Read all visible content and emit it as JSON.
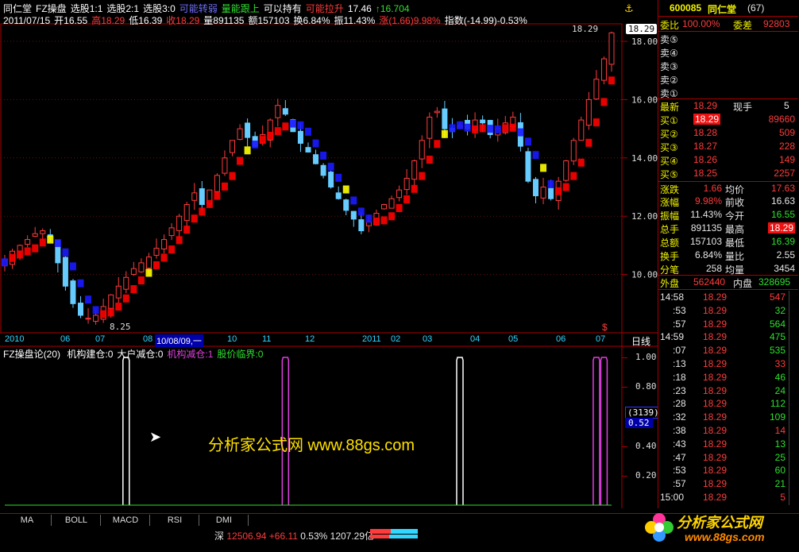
{
  "header": {
    "line1": [
      {
        "text": "同仁堂",
        "color": "#ffffff"
      },
      {
        "text": "FZ操盘",
        "color": "#ffffff"
      },
      {
        "text": "选股1:1",
        "color": "#ffffff"
      },
      {
        "text": "选股2:1",
        "color": "#ffffff"
      },
      {
        "text": "选股3:0",
        "color": "#ffffff"
      },
      {
        "text": "可能转弱",
        "color": "#6f6fff"
      },
      {
        "text": "量能跟上",
        "color": "#2ee02e"
      },
      {
        "text": "可以持有",
        "color": "#ffffff"
      },
      {
        "text": "可能拉升",
        "color": "#ff3b3b"
      },
      {
        "text": "17.46",
        "color": "#ffffff"
      },
      {
        "text": "↑16.704",
        "color": "#2ee02e"
      }
    ],
    "line2": [
      {
        "text": "2011/07/15",
        "color": "#ffffff"
      },
      {
        "text": "开16.55",
        "color": "#ffffff"
      },
      {
        "text": "高18.29",
        "color": "#ff3b3b"
      },
      {
        "text": "低16.39",
        "color": "#ffffff"
      },
      {
        "text": "收18.29",
        "color": "#ff3b3b"
      },
      {
        "text": "量891135",
        "color": "#ffffff"
      },
      {
        "text": "额157103",
        "color": "#ffffff"
      },
      {
        "text": "换6.84%",
        "color": "#ffffff"
      },
      {
        "text": "振11.43%",
        "color": "#ffffff"
      },
      {
        "text": "涨(1.66)9.98%",
        "color": "#ff3b3b"
      },
      {
        "text": "指数(-14.99)-0.53%",
        "color": "#ffffff"
      }
    ]
  },
  "price_axis": {
    "labels": [
      "18.00",
      "16.00",
      "14.00",
      "12.00",
      "10.00"
    ],
    "marker": "18.29",
    "low_marker": "8.25",
    "high_marker": "18.29"
  },
  "time_axis": {
    "labels": [
      "2010",
      "06",
      "07",
      "08",
      "10/08/09,一",
      "10",
      "11",
      "12",
      "2011",
      "02",
      "03",
      "04",
      "05",
      "06",
      "07"
    ],
    "period_label": "日线"
  },
  "indicator": {
    "title": "FZ操盘论(20)",
    "items": [
      {
        "text": "机构建仓:0",
        "color": "#ffffff"
      },
      {
        "text": "大户减仓:0",
        "color": "#ffffff"
      },
      {
        "text": "机构减仓:1",
        "color": "#e040e0"
      },
      {
        "text": "股价临界:0",
        "color": "#2ee02e"
      }
    ],
    "axis_labels": [
      "1.00",
      "0.80",
      "0.40",
      "0.20"
    ],
    "cursor_count": "(3139)",
    "cursor_value": "0.52",
    "watermark": "分析家公式网 www.88gs.com"
  },
  "tabs": [
    "MA",
    "BOLL",
    "MACD",
    "RSI",
    "DMI"
  ],
  "status": {
    "market": "深",
    "index": "12506.94",
    "change": "+66.11",
    "pct": "0.53%",
    "amount": "1207.29亿"
  },
  "right": {
    "code": "600085",
    "name": "同仁堂",
    "pos": "(67)",
    "wb_label": "委比",
    "wb_value": "100.00%",
    "wc_label": "委差",
    "wc_value": "92803",
    "asks": [
      {
        "label": "卖⑤"
      },
      {
        "label": "卖④"
      },
      {
        "label": "卖③"
      },
      {
        "label": "卖②"
      },
      {
        "label": "卖①"
      }
    ],
    "last_label": "最新",
    "last": "18.29",
    "xs_label": "现手",
    "xs": "5",
    "bids": [
      {
        "label": "买①",
        "price": "18.29",
        "vol": "89660"
      },
      {
        "label": "买②",
        "price": "18.28",
        "vol": "509"
      },
      {
        "label": "买③",
        "price": "18.27",
        "vol": "228"
      },
      {
        "label": "买④",
        "price": "18.26",
        "vol": "149"
      },
      {
        "label": "买⑤",
        "price": "18.25",
        "vol": "2257"
      }
    ],
    "stats": [
      {
        "l1": "涨跌",
        "v1": "1.66",
        "c1": "#ff3b3b",
        "l2": "均价",
        "v2": "17.63",
        "c2": "#ff3b3b"
      },
      {
        "l1": "涨幅",
        "v1": "9.98%",
        "c1": "#ff3b3b",
        "l2": "前收",
        "v2": "16.63",
        "c2": "#e6e6e6"
      },
      {
        "l1": "振幅",
        "v1": "11.43%",
        "c1": "#e6e6e6",
        "l2": "今开",
        "v2": "16.55",
        "c2": "#2ee02e"
      },
      {
        "l1": "总手",
        "v1": "891135",
        "c1": "#e6e6e6",
        "l2": "最高",
        "v2": "18.29",
        "c2": "#ffffff"
      },
      {
        "l1": "总额",
        "v1": "157103",
        "c1": "#e6e6e6",
        "l2": "最低",
        "v2": "16.39",
        "c2": "#2ee02e"
      },
      {
        "l1": "换手",
        "v1": "6.84%",
        "c1": "#e6e6e6",
        "l2": "量比",
        "v2": "2.55",
        "c2": "#e6e6e6"
      },
      {
        "l1": "分笔",
        "v1": "258",
        "c1": "#e6e6e6",
        "l2": "均量",
        "v2": "3454",
        "c2": "#e6e6e6"
      }
    ],
    "wp_label": "外盘",
    "wp": "562440",
    "np_label": "内盘",
    "np": "328695",
    "ticks": [
      {
        "t": "14:58",
        "p": "18.29",
        "v": "547"
      },
      {
        "t": ":53",
        "p": "18.29",
        "v": "32"
      },
      {
        "t": ":57",
        "p": "18.29",
        "v": "564"
      },
      {
        "t": "14:59",
        "p": "18.29",
        "v": "475"
      },
      {
        "t": ":07",
        "p": "18.29",
        "v": "535"
      },
      {
        "t": ":13",
        "p": "18.29",
        "v": "33"
      },
      {
        "t": ":18",
        "p": "18.29",
        "v": "46"
      },
      {
        "t": ":23",
        "p": "18.29",
        "v": "24"
      },
      {
        "t": ":28",
        "p": "18.29",
        "v": "112"
      },
      {
        "t": ":32",
        "p": "18.29",
        "v": "109"
      },
      {
        "t": ":38",
        "p": "18.29",
        "v": "14"
      },
      {
        "t": ":43",
        "p": "18.29",
        "v": "13"
      },
      {
        "t": ":47",
        "p": "18.29",
        "v": "25"
      },
      {
        "t": ":53",
        "p": "18.29",
        "v": "60"
      },
      {
        "t": ":57",
        "p": "18.29",
        "v": "21"
      },
      {
        "t": "15:00",
        "p": "18.29",
        "v": "5"
      }
    ]
  },
  "logo": {
    "text": "分析家公式网",
    "url": "www.88gs.com"
  },
  "colors": {
    "up": "#ff3b3b",
    "down": "#2ee02e",
    "frame": "#aa0000",
    "blue": "#1a1aff",
    "yellow": "#ffff00",
    "magenta": "#e040e0"
  },
  "chart_data": {
    "type": "candlestick",
    "ylim": [
      8,
      18.6
    ],
    "closes": [
      10.5,
      10.8,
      11.0,
      11.2,
      11.4,
      11.5,
      11.3,
      10.4,
      9.6,
      9.0,
      8.6,
      8.5,
      8.6,
      8.9,
      9.3,
      9.6,
      9.9,
      10.2,
      10.4,
      10.6,
      10.9,
      11.2,
      11.6,
      12.0,
      12.4,
      12.8,
      12.4,
      12.9,
      13.4,
      14.0,
      14.6,
      15.0,
      14.7,
      14.4,
      14.8,
      15.3,
      15.8,
      15.5,
      14.9,
      14.5,
      14.2,
      13.8,
      13.4,
      13.0,
      12.6,
      12.2,
      11.9,
      11.5,
      11.8,
      12.1,
      12.4,
      12.6,
      12.9,
      13.3,
      13.9,
      14.6,
      15.4,
      15.6,
      15.0,
      14.9,
      15.1,
      15.0,
      15.3,
      15.2,
      14.8,
      15.0,
      15.2,
      15.4,
      14.4,
      13.2,
      12.7,
      13.0,
      12.6,
      13.2,
      13.9,
      14.6,
      15.3,
      16.0,
      16.7,
      17.4,
      18.29
    ],
    "indicator_signals": [
      {
        "i": 16,
        "value": 1.0,
        "series": "机构建仓"
      },
      {
        "i": 37,
        "value": 1.0,
        "series": "机构减仓"
      },
      {
        "i": 60,
        "value": 1.0,
        "series": "机构建仓"
      },
      {
        "i": 78,
        "value": 1.0,
        "series": "机构减仓"
      },
      {
        "i": 79,
        "value": 1.0,
        "series": "机构减仓"
      }
    ]
  }
}
